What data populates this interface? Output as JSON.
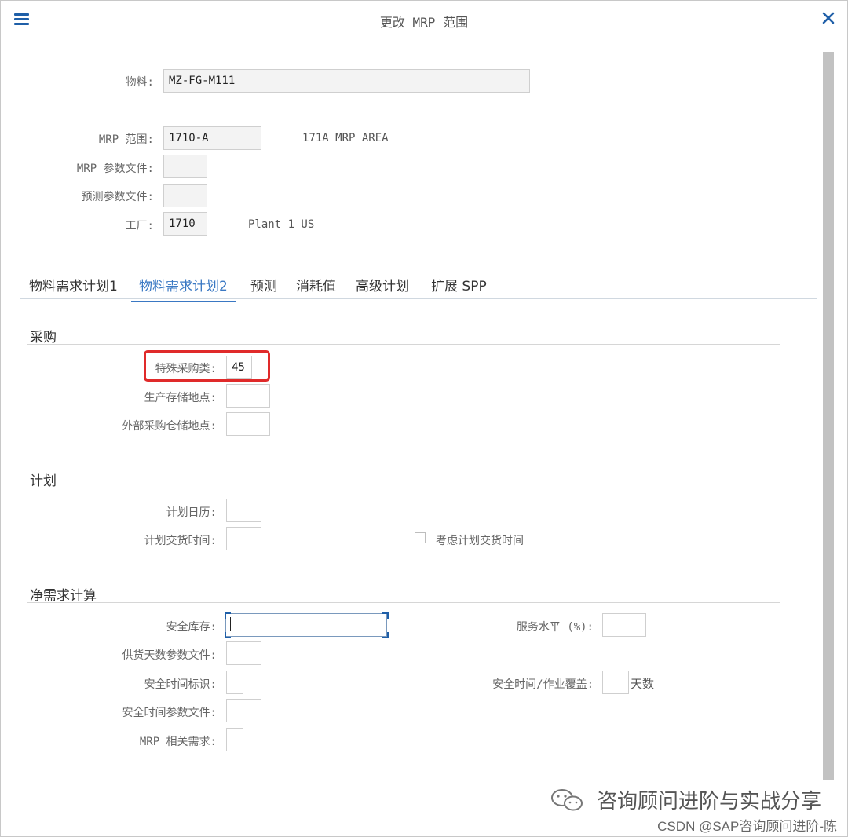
{
  "window": {
    "title": "更改 MRP 范围"
  },
  "header": {
    "material_label": "物料:",
    "material_value": "MZ-FG-M111",
    "mrp_area_label": "MRP 范围:",
    "mrp_area_value": "1710-A",
    "mrp_area_desc": "171A_MRP AREA",
    "mrp_profile_label": "MRP 参数文件:",
    "mrp_profile_value": "",
    "forecast_profile_label": "预测参数文件:",
    "forecast_profile_value": "",
    "plant_label": "工厂:",
    "plant_value": "1710",
    "plant_desc": "Plant 1 US"
  },
  "tabs": [
    {
      "label": "物料需求计划1",
      "active": false
    },
    {
      "label": "物料需求计划2",
      "active": true
    },
    {
      "label": "预测",
      "active": false
    },
    {
      "label": "消耗值",
      "active": false
    },
    {
      "label": "高级计划",
      "active": false
    },
    {
      "label": "扩展 SPP",
      "active": false
    }
  ],
  "procurement": {
    "title": "采购",
    "special_proc_label": "特殊采购类:",
    "special_proc_value": "45",
    "prod_sloc_label": "生产存储地点:",
    "prod_sloc_value": "",
    "ext_sloc_label": "外部采购仓储地点:",
    "ext_sloc_value": ""
  },
  "planning": {
    "title": "计划",
    "calendar_label": "计划日历:",
    "calendar_value": "",
    "delivery_time_label": "计划交货时间:",
    "delivery_time_value": "",
    "consider_delivery_label": "考虑计划交货时间",
    "consider_delivery_checked": false
  },
  "net_requirements": {
    "title": "净需求计算",
    "safety_stock_label": "安全库存:",
    "safety_stock_value": "",
    "service_level_label": "服务水平 (%):",
    "service_level_value": "",
    "coverage_profile_label": "供货天数参数文件:",
    "coverage_profile_value": "",
    "safety_time_ind_label": "安全时间标识:",
    "safety_time_ind_value": "",
    "safety_time_cov_label": "安全时间/作业覆盖:",
    "safety_time_cov_value": "",
    "days_label": "天数",
    "safety_time_profile_label": "安全时间参数文件:",
    "safety_time_profile_value": "",
    "mrp_dep_req_label": "MRP 相关需求:",
    "mrp_dep_req_value": ""
  },
  "watermark": {
    "text": "咨询顾问进阶与实战分享",
    "csdn": "CSDN @SAP咨询顾问进阶-陈"
  },
  "colors": {
    "accent": "#3a78c3",
    "highlight_border": "#e02a2a",
    "icon_blue": "#1f5fa8"
  }
}
